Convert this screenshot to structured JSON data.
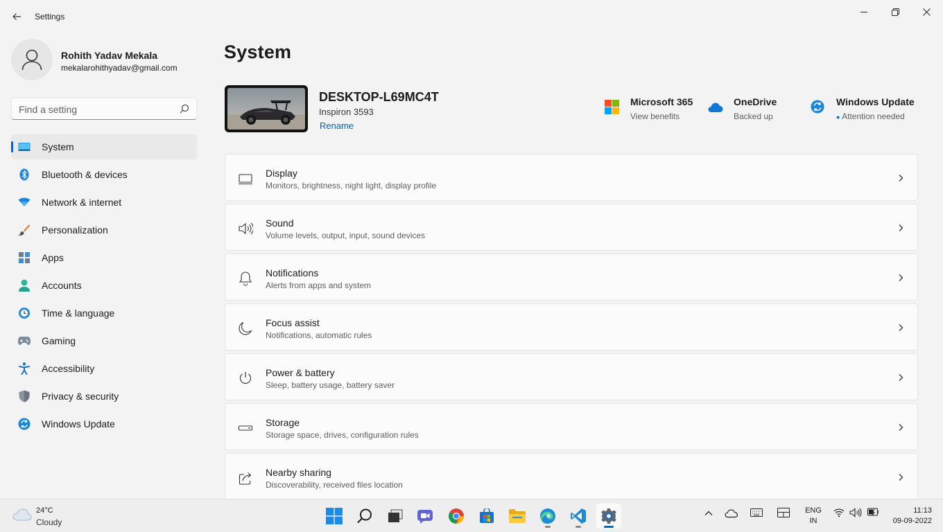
{
  "window": {
    "title": "Settings",
    "back": "back",
    "controls": [
      "minimize",
      "maximize",
      "close"
    ]
  },
  "profile": {
    "name": "Rohith Yadav Mekala",
    "email": "mekalarohithyadav@gmail.com"
  },
  "search": {
    "placeholder": "Find a setting",
    "value": ""
  },
  "sidebar": {
    "items": [
      {
        "label": "System",
        "icon": "monitor-icon",
        "active": true
      },
      {
        "label": "Bluetooth & devices",
        "icon": "bluetooth-icon"
      },
      {
        "label": "Network & internet",
        "icon": "wifi-icon"
      },
      {
        "label": "Personalization",
        "icon": "brush-icon"
      },
      {
        "label": "Apps",
        "icon": "apps-icon"
      },
      {
        "label": "Accounts",
        "icon": "person-icon"
      },
      {
        "label": "Time & language",
        "icon": "globe-clock-icon"
      },
      {
        "label": "Gaming",
        "icon": "gamepad-icon"
      },
      {
        "label": "Accessibility",
        "icon": "accessibility-icon"
      },
      {
        "label": "Privacy & security",
        "icon": "shield-icon"
      },
      {
        "label": "Windows Update",
        "icon": "update-icon"
      }
    ]
  },
  "main": {
    "title": "System",
    "device": {
      "name": "DESKTOP-L69MC4T",
      "model": "Inspiron 3593",
      "rename": "Rename"
    },
    "quick_status": [
      {
        "title": "Microsoft 365",
        "subtitle": "View benefits",
        "icon": "microsoft-logo-icon"
      },
      {
        "title": "OneDrive",
        "subtitle": "Backed up",
        "icon": "onedrive-cloud-icon"
      },
      {
        "title": "Windows Update",
        "subtitle": "Attention needed",
        "icon": "windows-update-icon"
      }
    ],
    "cards": [
      {
        "title": "Display",
        "subtitle": "Monitors, brightness, night light, display profile",
        "icon": "display-icon"
      },
      {
        "title": "Sound",
        "subtitle": "Volume levels, output, input, sound devices",
        "icon": "speaker-icon"
      },
      {
        "title": "Notifications",
        "subtitle": "Alerts from apps and system",
        "icon": "bell-icon"
      },
      {
        "title": "Focus assist",
        "subtitle": "Notifications, automatic rules",
        "icon": "moon-icon"
      },
      {
        "title": "Power & battery",
        "subtitle": "Sleep, battery usage, battery saver",
        "icon": "power-icon"
      },
      {
        "title": "Storage",
        "subtitle": "Storage space, drives, configuration rules",
        "icon": "drive-icon"
      },
      {
        "title": "Nearby sharing",
        "subtitle": "Discoverability, received files location",
        "icon": "share-icon"
      }
    ]
  },
  "taskbar": {
    "weather": {
      "temp": "24°C",
      "condition": "Cloudy"
    },
    "apps": [
      "start",
      "search",
      "task-view",
      "teams-chat",
      "chrome",
      "store",
      "file-explorer",
      "edge",
      "vscode",
      "settings"
    ],
    "language": {
      "line1": "ENG",
      "line2": "IN"
    },
    "clock": {
      "time": "11:13",
      "date": "09-09-2022"
    }
  },
  "colors": {
    "accent": "#0067c0",
    "window_bg": "#f3f3f3",
    "card_bg": "#fbfbfb"
  }
}
